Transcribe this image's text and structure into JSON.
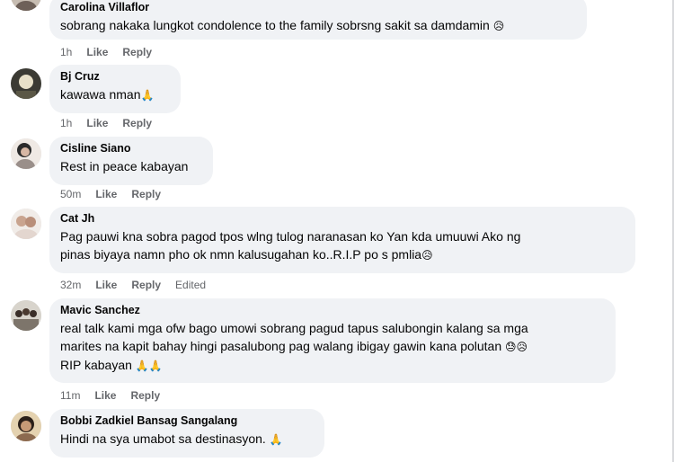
{
  "comments": [
    {
      "author": "Carolina Villaflor",
      "text": "sobrang nakaka lungkot condolence to the family sobrsng sakit sa damdamin",
      "emoji": "😥",
      "time": "1h",
      "like": "Like",
      "reply": "Reply"
    },
    {
      "author": "Bj Cruz",
      "text": "kawawa nman",
      "emoji": "🙏",
      "time": "1h",
      "like": "Like",
      "reply": "Reply"
    },
    {
      "author": "Cisline Siano",
      "text": "Rest in peace kabayan",
      "time": "50m",
      "like": "Like",
      "reply": "Reply"
    },
    {
      "author": "Cat Jh",
      "text": "Pag pauwi kna sobra pagod tpos wlng tulog naranasan ko Yan kda umuuwi Ako ng\npinas biyaya namn pho ok nmn kalusugahan ko..R.I.P po s pmlia",
      "emoji": "😥",
      "time": "32m",
      "like": "Like",
      "reply": "Reply",
      "edited": "Edited"
    },
    {
      "author": "Mavic Sanchez",
      "text": "real talk kami mga ofw bago umowi sobrang pagud tapus salubongin kalang sa mga\nmarites na kapit bahay hingi pasalubong pag walang ibigay gawin kana polutan",
      "emoji_line": "😓😥",
      "text_line3": "RIP kabayan",
      "emoji3": "🙏🙏",
      "time": "11m",
      "like": "Like",
      "reply": "Reply"
    },
    {
      "author": "Bobbi Zadkiel Bansag Sangalang",
      "text": "Hindi na sya umabot sa destinasyon.",
      "emoji": "🙏"
    }
  ]
}
